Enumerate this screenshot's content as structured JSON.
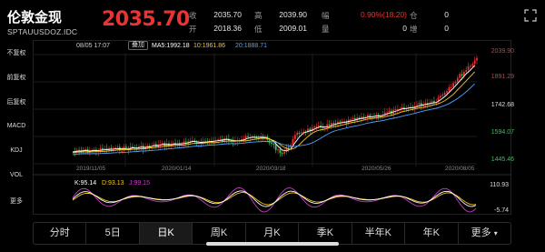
{
  "header": {
    "name": "伦敦金现",
    "code": "SPTAUUSDOZ.IDC",
    "price": "2035.70",
    "stats": [
      {
        "label": "收",
        "value": "2035.70",
        "red": false
      },
      {
        "label": "开",
        "value": "2018.36",
        "red": false
      },
      {
        "label": "高",
        "value": "2039.90",
        "red": false
      },
      {
        "label": "低",
        "value": "2009.01",
        "red": false
      },
      {
        "label": "幅",
        "value": "0.90%(18.20)",
        "red": true
      },
      {
        "label": "量",
        "value": "0",
        "red": false
      },
      {
        "label": "仓",
        "value": "0",
        "red": false
      },
      {
        "label": "增",
        "value": "0",
        "red": false
      }
    ]
  },
  "sidebar": {
    "items": [
      {
        "label": "不复权",
        "state": "active"
      },
      {
        "label": "前复权",
        "state": "dim"
      },
      {
        "label": "后复权",
        "state": "dim"
      },
      {
        "label": "MACD",
        "state": "normal"
      },
      {
        "label": "KDJ",
        "state": "active"
      },
      {
        "label": "VOL",
        "state": "normal"
      },
      {
        "label": "更多",
        "state": "normal"
      }
    ]
  },
  "chart": {
    "datetime": "08/05 17:07",
    "restore_label": "叠加",
    "ma": [
      {
        "label": "MA5:",
        "value": "1992.18",
        "color": "#ffffff"
      },
      {
        "label": "10:",
        "value": "1961.86",
        "color": "#f5c518"
      },
      {
        "label": "20:",
        "value": "1888.71",
        "color": "#4aa3ff"
      }
    ],
    "price_axis": [
      {
        "value": "2039.90",
        "color": "#e83434"
      },
      {
        "value": "1891.29",
        "color": "#e83434"
      },
      {
        "value": "1742.68",
        "color": "#dddddd"
      },
      {
        "value": "1594.07",
        "color": "#3fbf5f"
      },
      {
        "value": "1445.46",
        "color": "#3fbf5f"
      }
    ],
    "dates": [
      "2019/11/05",
      "2020/01/14",
      "2020/03/18",
      "2020/05/26",
      "2020/08/05"
    ],
    "kdj": [
      {
        "label": "K:",
        "value": "95.14",
        "color": "#ffffff"
      },
      {
        "label": "D:",
        "value": "93.13",
        "color": "#f5c518"
      },
      {
        "label": "J:",
        "value": "99.15",
        "color": "#c040c0"
      }
    ],
    "kdj_axis": [
      "110.93",
      "-5.74"
    ]
  },
  "tabs": [
    {
      "label": "分时",
      "active": false
    },
    {
      "label": "5日",
      "active": false
    },
    {
      "label": "日K",
      "active": true
    },
    {
      "label": "周K",
      "active": false
    },
    {
      "label": "月K",
      "active": false
    },
    {
      "label": "季K",
      "active": false
    },
    {
      "label": "半年K",
      "active": false
    },
    {
      "label": "年K",
      "active": false
    },
    {
      "label": "更多",
      "active": false
    }
  ],
  "colors": {
    "up": "#e83434",
    "down": "#3fbf5f",
    "accent": "#4aa3ff"
  }
}
